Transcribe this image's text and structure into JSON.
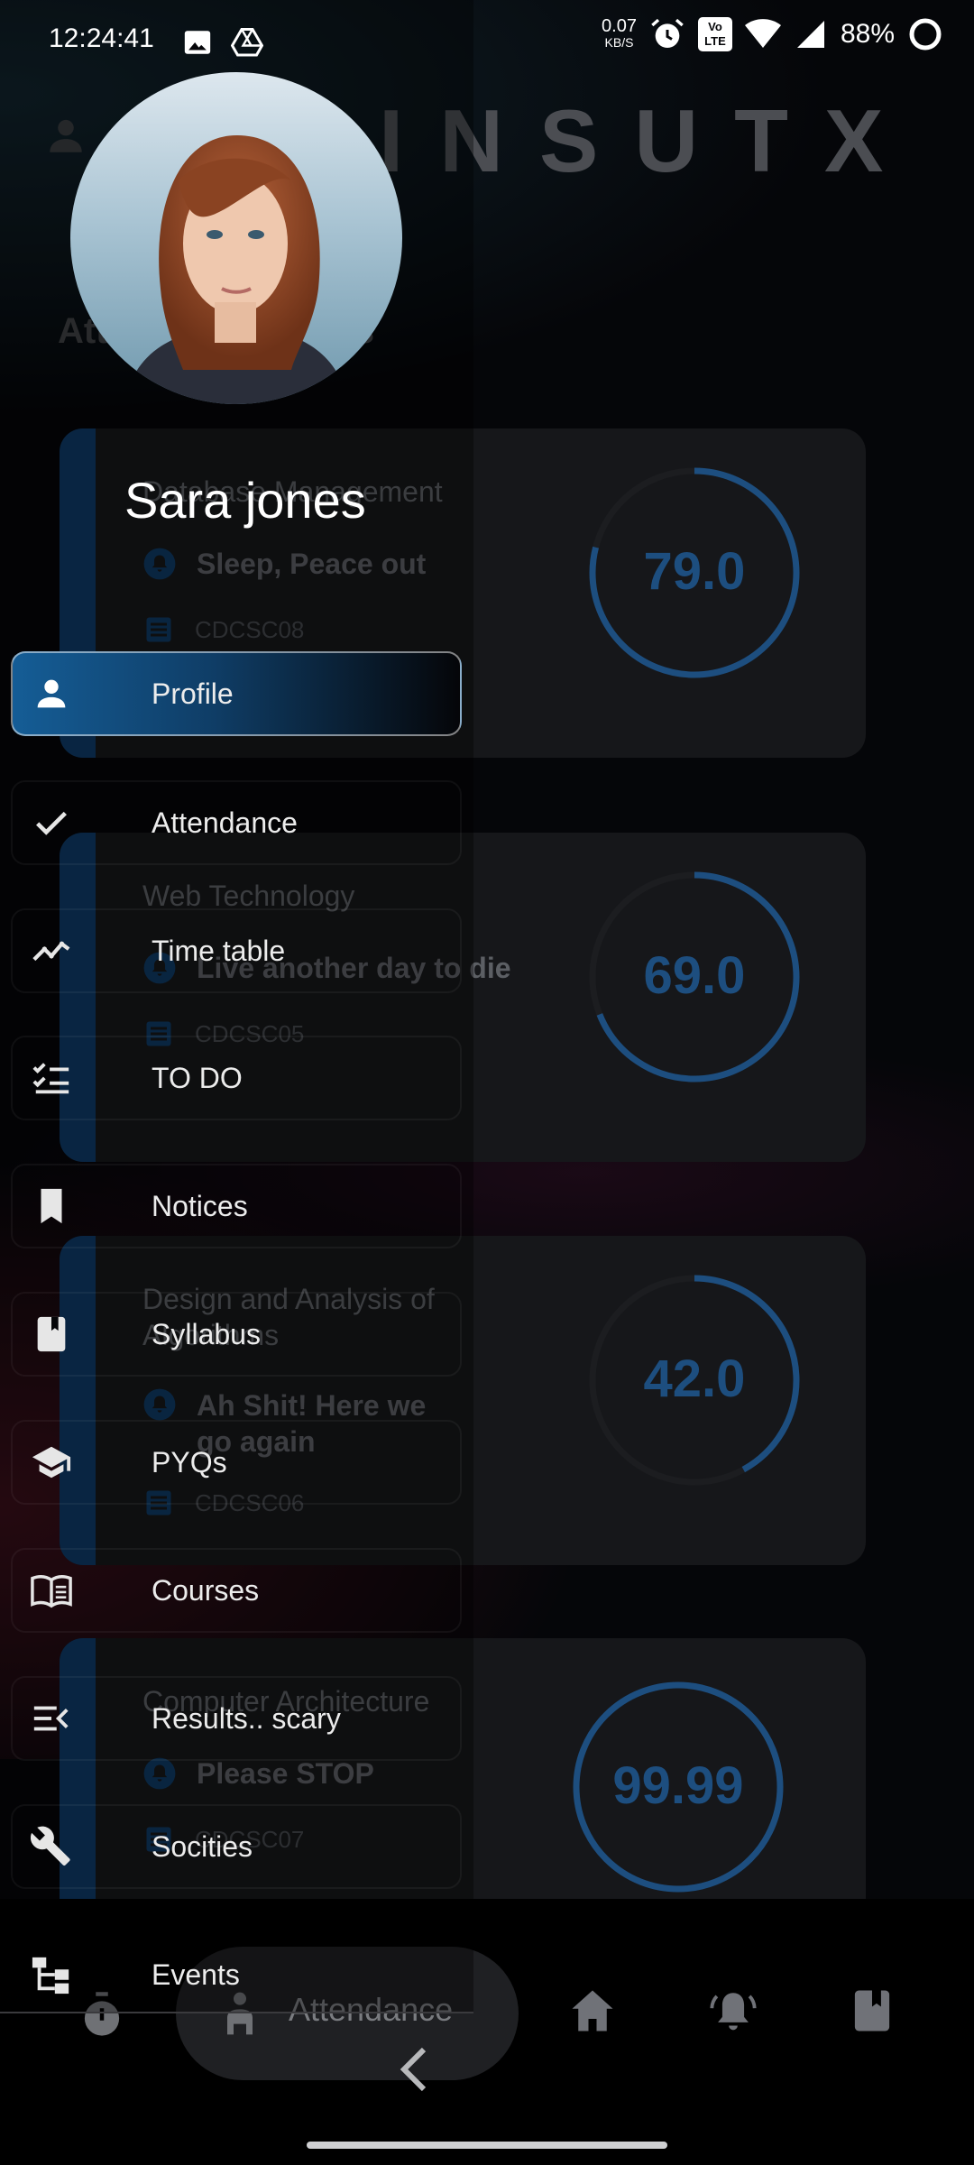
{
  "status_bar": {
    "time": "12:24:41",
    "speed_value": "0.07",
    "speed_unit": "KB/S",
    "network_badge": "LTE",
    "battery": "88%"
  },
  "app": {
    "title": "INSUTX",
    "section_title": "Attendance Status"
  },
  "cards": [
    {
      "subject": "Database Management",
      "quote": "Sleep, Peace out",
      "code": "CDCSC08",
      "value": "79.0",
      "percent": 79.0
    },
    {
      "subject": "Web Technology",
      "quote": "Live another day to die",
      "code": "CDCSC05",
      "value": "69.0",
      "percent": 69.0
    },
    {
      "subject": "Design and Analysis of Algorithms",
      "quote": "Ah Shit! Here we go again",
      "code": "CDCSC06",
      "value": "42.0",
      "percent": 42.0
    },
    {
      "subject": "Computer Architecture",
      "quote": "Please STOP",
      "code": "CDCSC07",
      "value": "99.99",
      "percent": 99.99
    }
  ],
  "drawer": {
    "username": "Sara jones",
    "items": [
      {
        "label": "Profile",
        "icon": "person-icon"
      },
      {
        "label": "Attendance",
        "icon": "check-icon"
      },
      {
        "label": "Time table",
        "icon": "trend-icon"
      },
      {
        "label": "TO DO",
        "icon": "checklist-icon"
      },
      {
        "label": "Notices",
        "icon": "bookmark-icon"
      },
      {
        "label": "Syllabus",
        "icon": "book-icon"
      },
      {
        "label": "PYQs",
        "icon": "graduation-cap-icon"
      },
      {
        "label": "Courses",
        "icon": "open-book-icon"
      },
      {
        "label": "Results.. scary",
        "icon": "menu-collapse-icon"
      },
      {
        "label": "Socities",
        "icon": "wrench-icon"
      },
      {
        "label": "Events",
        "icon": "hierarchy-icon"
      }
    ]
  },
  "bottom_nav": {
    "active_label": "Attendance"
  },
  "colors": {
    "accent": "#155d96",
    "ring": "#1d4e7f",
    "background": "#050609"
  }
}
